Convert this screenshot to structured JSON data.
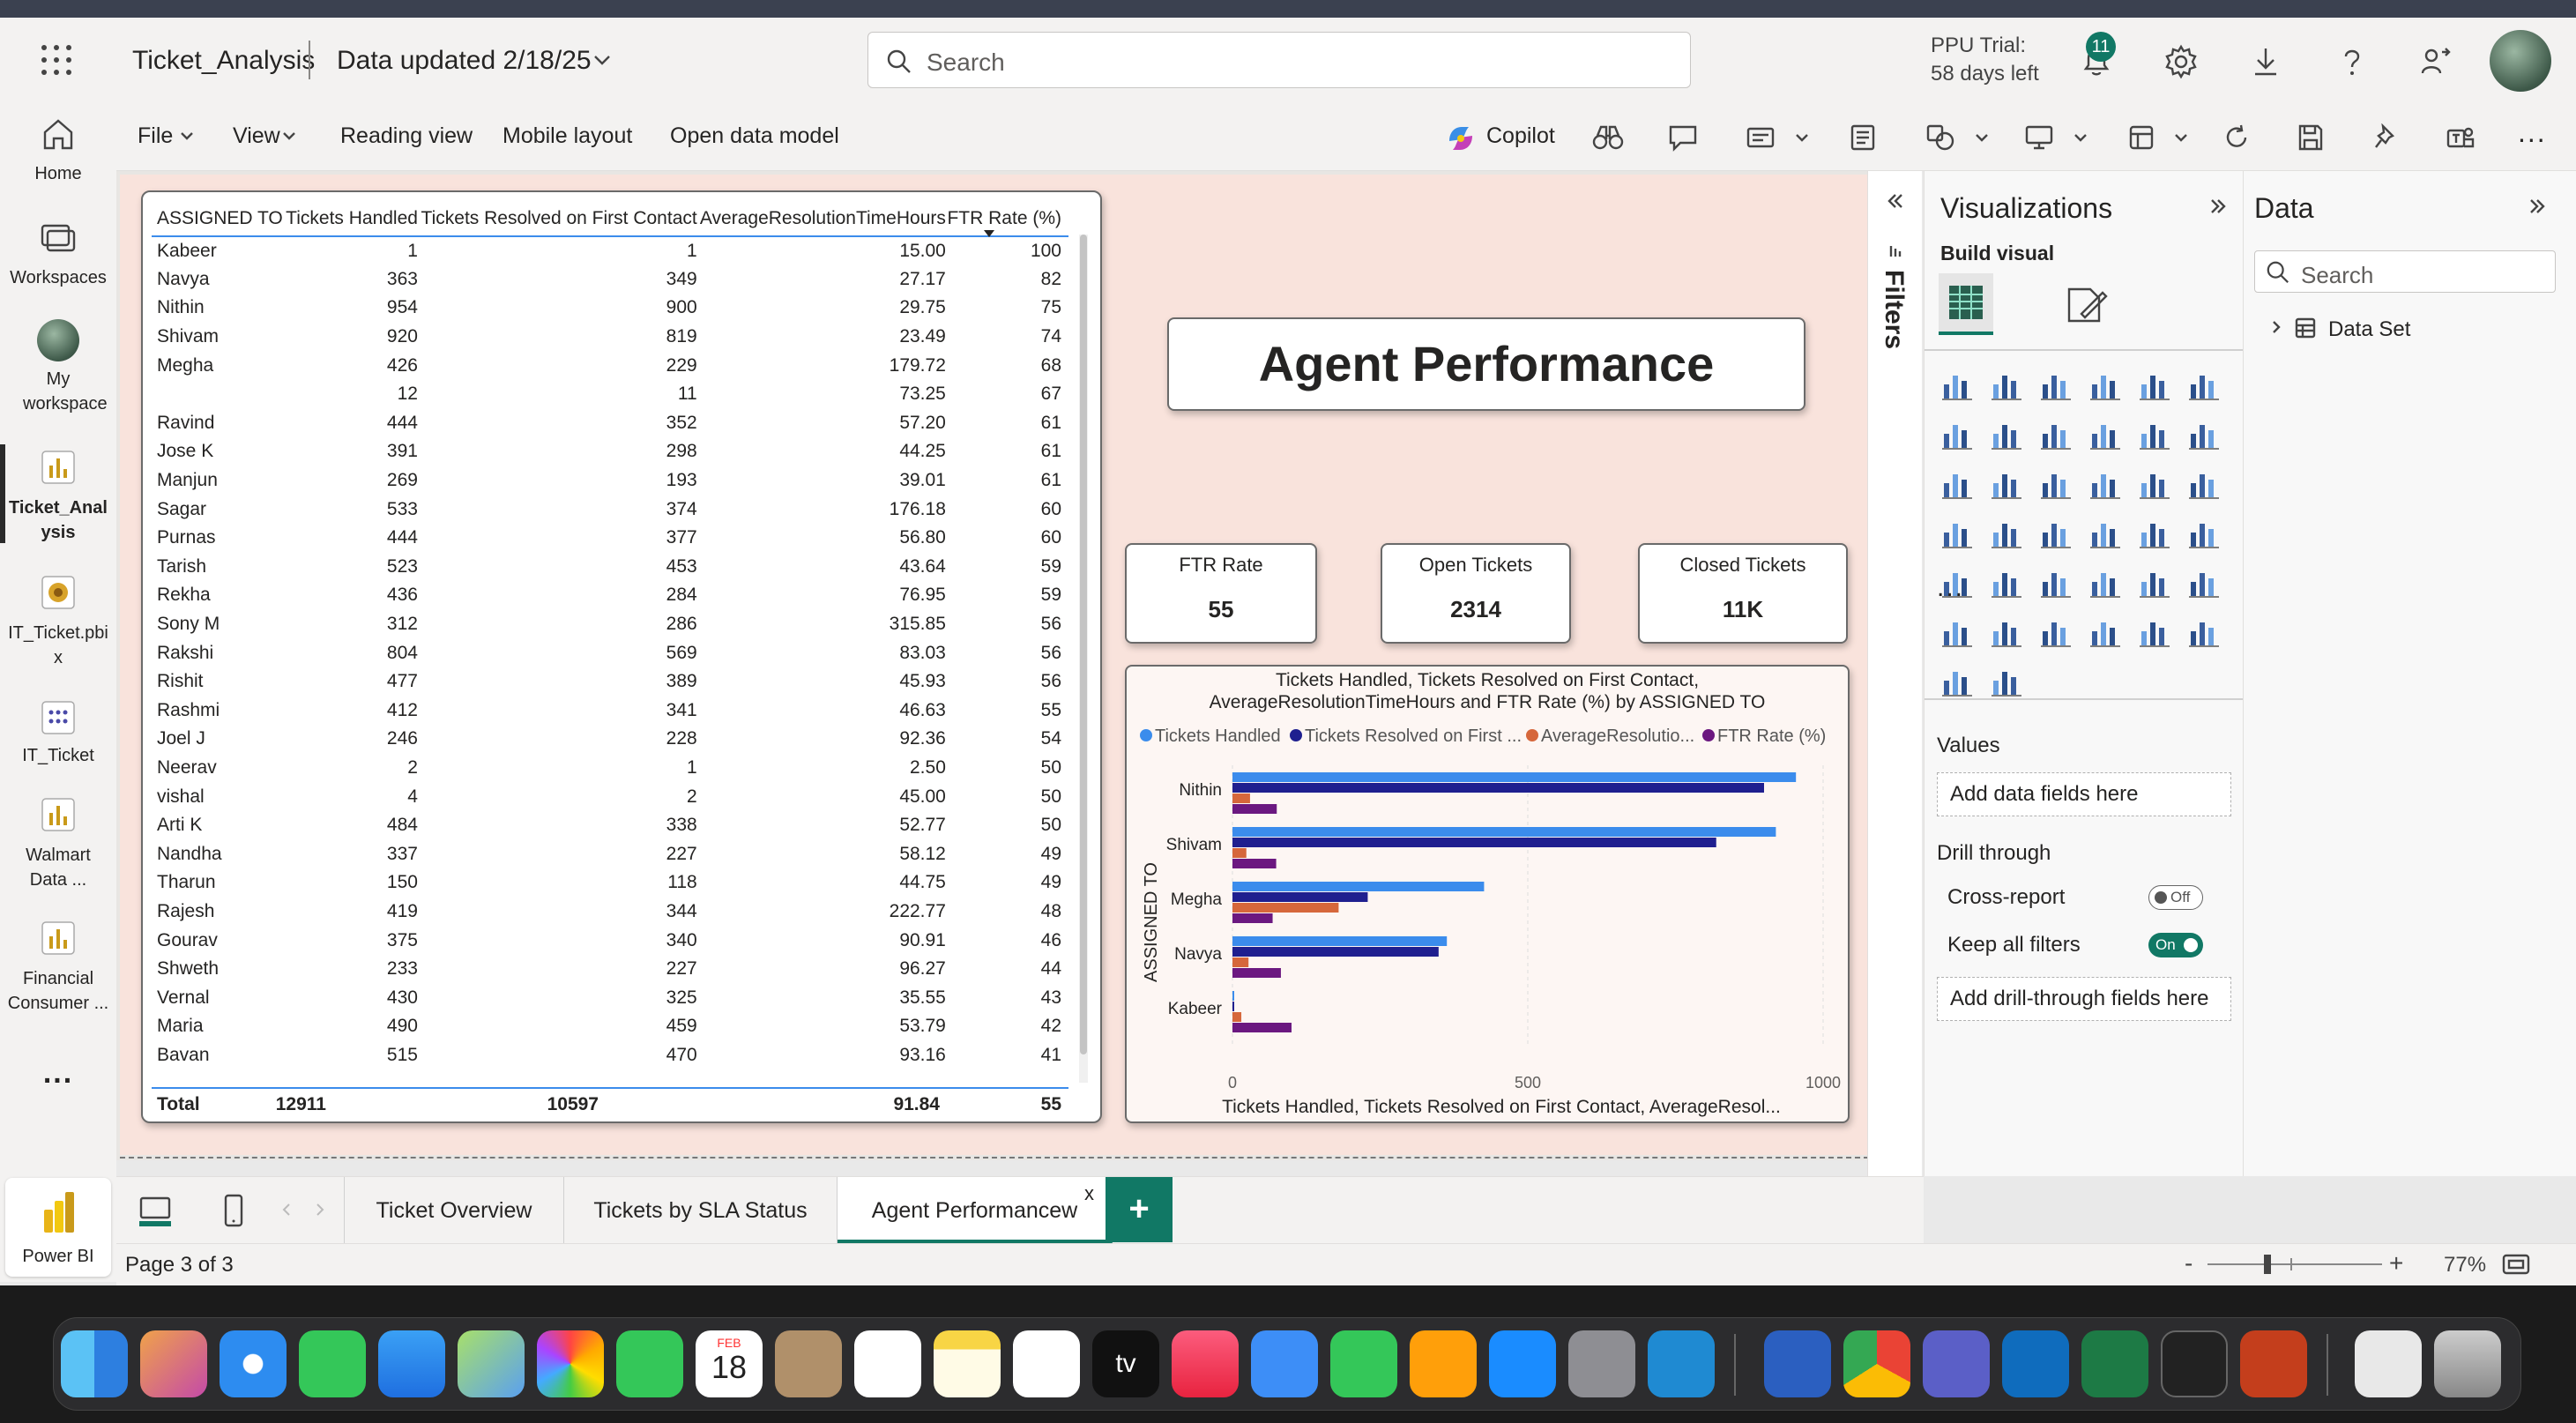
{
  "header": {
    "app_title": "Ticket_Analysis",
    "data_updated": "Data updated 2/18/25",
    "search_placeholder": "Search",
    "trial_line1": "PPU Trial:",
    "trial_line2": "58 days left",
    "notification_count": "11"
  },
  "leftnav": {
    "items": [
      {
        "label": "Home"
      },
      {
        "label": "Workspaces"
      },
      {
        "label": "My workspace"
      },
      {
        "label": "Ticket_Analysis"
      },
      {
        "label": "IT_Ticket.pbix"
      },
      {
        "label": "IT_Ticket"
      },
      {
        "label": "Walmart Data ..."
      },
      {
        "label": "Financial Consumer ..."
      }
    ],
    "more": "...",
    "powerbi_label": "Power BI"
  },
  "ribbon": {
    "file": "File",
    "view": "View",
    "reading_view": "Reading view",
    "mobile_layout": "Mobile layout",
    "open_data_model": "Open data model",
    "copilot": "Copilot",
    "more": "..."
  },
  "table": {
    "headers": [
      "ASSIGNED TO",
      "Tickets Handled",
      "Tickets Resolved on First Contact",
      "AverageResolutionTimeHours",
      "FTR Rate (%)"
    ],
    "rows": [
      [
        "Kabeer",
        "1",
        "1",
        "15.00",
        "100"
      ],
      [
        "Navya",
        "363",
        "349",
        "27.17",
        "82"
      ],
      [
        "Nithin",
        "954",
        "900",
        "29.75",
        "75"
      ],
      [
        "Shivam",
        "920",
        "819",
        "23.49",
        "74"
      ],
      [
        "Megha",
        "426",
        "229",
        "179.72",
        "68"
      ],
      [
        "",
        "12",
        "11",
        "73.25",
        "67"
      ],
      [
        "Ravind",
        "444",
        "352",
        "57.20",
        "61"
      ],
      [
        "Jose K",
        "391",
        "298",
        "44.25",
        "61"
      ],
      [
        "Manjun",
        "269",
        "193",
        "39.01",
        "61"
      ],
      [
        "Sagar",
        "533",
        "374",
        "176.18",
        "60"
      ],
      [
        "Purnas",
        "444",
        "377",
        "56.80",
        "60"
      ],
      [
        "Tarish",
        "523",
        "453",
        "43.64",
        "59"
      ],
      [
        "Rekha",
        "436",
        "284",
        "76.95",
        "59"
      ],
      [
        "Sony M",
        "312",
        "286",
        "315.85",
        "56"
      ],
      [
        "Rakshi",
        "804",
        "569",
        "83.03",
        "56"
      ],
      [
        "Rishit",
        "477",
        "389",
        "45.93",
        "56"
      ],
      [
        "Rashmi",
        "412",
        "341",
        "46.63",
        "55"
      ],
      [
        "Joel J",
        "246",
        "228",
        "92.36",
        "54"
      ],
      [
        "Neerav",
        "2",
        "1",
        "2.50",
        "50"
      ],
      [
        "vishal",
        "4",
        "2",
        "45.00",
        "50"
      ],
      [
        "Arti K",
        "484",
        "338",
        "52.77",
        "50"
      ],
      [
        "Nandha",
        "337",
        "227",
        "58.12",
        "49"
      ],
      [
        "Tharun",
        "150",
        "118",
        "44.75",
        "49"
      ],
      [
        "Rajesh",
        "419",
        "344",
        "222.77",
        "48"
      ],
      [
        "Gourav",
        "375",
        "340",
        "90.91",
        "46"
      ],
      [
        "Shweth",
        "233",
        "227",
        "96.27",
        "44"
      ],
      [
        "Vernal",
        "430",
        "325",
        "35.55",
        "43"
      ],
      [
        "Maria",
        "490",
        "459",
        "53.79",
        "42"
      ],
      [
        "Bavan",
        "515",
        "470",
        "93.16",
        "41"
      ]
    ],
    "total": [
      "Total",
      "12911",
      "10597",
      "91.84",
      "55"
    ]
  },
  "title_card": "Agent Performance",
  "kpis": [
    {
      "label": "FTR Rate",
      "value": "55"
    },
    {
      "label": "Open Tickets",
      "value": "2314"
    },
    {
      "label": "Closed Tickets",
      "value": "11K"
    }
  ],
  "chart_data": {
    "type": "bar",
    "orientation": "horizontal",
    "title_line1": "Tickets Handled, Tickets Resolved on First Contact,",
    "title_line2": "AverageResolutionTimeHours and FTR Rate (%) by ASSIGNED TO",
    "ylabel": "ASSIGNED TO",
    "xlabel": "Tickets Handled, Tickets Resolved on First Contact, AverageResol...",
    "categories": [
      "Nithin",
      "Shivam",
      "Megha",
      "Navya",
      "Kabeer"
    ],
    "xlim": [
      0,
      1000
    ],
    "xticks": [
      "0",
      "500",
      "1000"
    ],
    "legend_position": "top",
    "grid": true,
    "series": [
      {
        "name": "Tickets Handled",
        "legend": "Tickets Handled",
        "color": "#3b8cec",
        "values": [
          954,
          920,
          426,
          363,
          1
        ]
      },
      {
        "name": "Tickets Resolved on First Contact",
        "legend": "Tickets Resolved on First ...",
        "color": "#1f1f8f",
        "values": [
          900,
          819,
          229,
          349,
          1
        ]
      },
      {
        "name": "AverageResolutionTimeHours",
        "legend": "AverageResolutio...",
        "color": "#d6673b",
        "values": [
          29.75,
          23.49,
          179.72,
          27.17,
          15
        ]
      },
      {
        "name": "FTR Rate (%)",
        "legend": "FTR Rate (%)",
        "color": "#6b1880",
        "values": [
          75,
          74,
          68,
          82,
          100
        ]
      }
    ]
  },
  "filters_label": "Filters",
  "viz_pane": {
    "title": "Visualizations",
    "build_visual": "Build visual",
    "values_label": "Values",
    "add_data_fields": "Add data fields here",
    "drill_through": "Drill through",
    "cross_report": "Cross-report",
    "cross_report_state": "Off",
    "keep_all_filters": "Keep all filters",
    "keep_all_filters_state": "On",
    "add_drill_fields": "Add drill-through fields here",
    "more": "..."
  },
  "data_pane": {
    "title": "Data",
    "search_placeholder": "Search",
    "dataset": "Data Set"
  },
  "tabs": [
    "Ticket Overview",
    "Tickets by SLA Status",
    "Agent Performancew"
  ],
  "tab_close": "x",
  "tab_add": "+",
  "status": {
    "page": "Page 3 of 3",
    "zoom": "77%",
    "minus": "-",
    "plus": "+"
  },
  "dock": {
    "calendar_month": "FEB",
    "calendar_day": "18",
    "tv_label": "tv"
  }
}
